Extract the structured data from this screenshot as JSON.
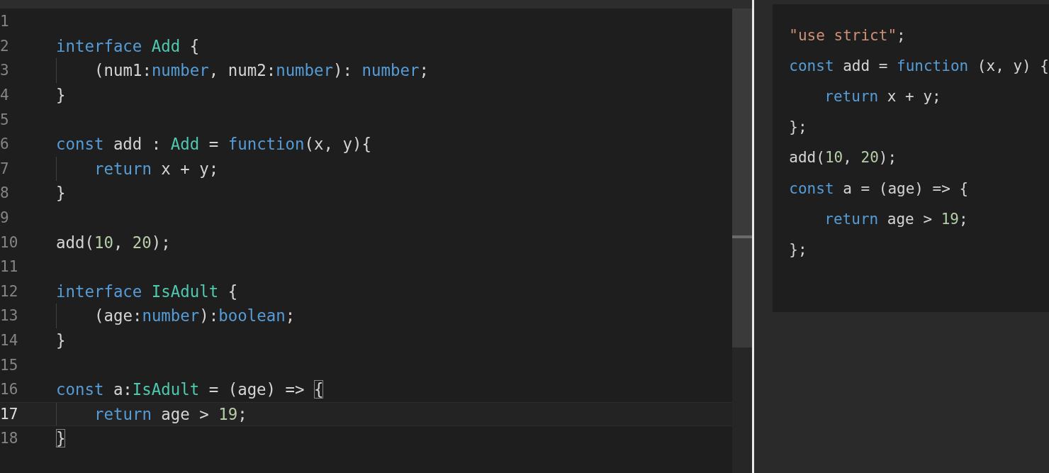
{
  "editor": {
    "lines": [
      {
        "number": "1",
        "current": false,
        "indented": false
      },
      {
        "number": "2",
        "current": false,
        "indented": false,
        "tokens": [
          {
            "text": "interface ",
            "kind": "keyword"
          },
          {
            "text": "Add",
            "kind": "type"
          },
          {
            "text": " {",
            "kind": "plain"
          }
        ]
      },
      {
        "number": "3",
        "current": false,
        "indented": true,
        "tokens": [
          {
            "text": "(num1:",
            "kind": "plain"
          },
          {
            "text": "number",
            "kind": "keyword"
          },
          {
            "text": ", num2:",
            "kind": "plain"
          },
          {
            "text": "number",
            "kind": "keyword"
          },
          {
            "text": "): ",
            "kind": "plain"
          },
          {
            "text": "number",
            "kind": "keyword"
          },
          {
            "text": ";",
            "kind": "plain"
          }
        ]
      },
      {
        "number": "4",
        "current": false,
        "indented": false,
        "tokens": [
          {
            "text": "}",
            "kind": "plain"
          }
        ]
      },
      {
        "number": "5",
        "current": false,
        "indented": false
      },
      {
        "number": "6",
        "current": false,
        "indented": false,
        "tokens": [
          {
            "text": "const",
            "kind": "keyword"
          },
          {
            "text": " add : ",
            "kind": "plain"
          },
          {
            "text": "Add",
            "kind": "type"
          },
          {
            "text": " = ",
            "kind": "plain"
          },
          {
            "text": "function",
            "kind": "keyword"
          },
          {
            "text": "(x, y){",
            "kind": "plain"
          }
        ]
      },
      {
        "number": "7",
        "current": false,
        "indented": true,
        "tokens": [
          {
            "text": "return",
            "kind": "keyword"
          },
          {
            "text": " x + y;",
            "kind": "plain"
          }
        ]
      },
      {
        "number": "8",
        "current": false,
        "indented": false,
        "tokens": [
          {
            "text": "}",
            "kind": "plain"
          }
        ]
      },
      {
        "number": "9",
        "current": false,
        "indented": false
      },
      {
        "number": "10",
        "current": false,
        "indented": false,
        "tokens": [
          {
            "text": "add(",
            "kind": "plain"
          },
          {
            "text": "10",
            "kind": "number"
          },
          {
            "text": ", ",
            "kind": "plain"
          },
          {
            "text": "20",
            "kind": "number"
          },
          {
            "text": ");",
            "kind": "plain"
          }
        ]
      },
      {
        "number": "11",
        "current": false,
        "indented": false
      },
      {
        "number": "12",
        "current": false,
        "indented": false,
        "tokens": [
          {
            "text": "interface ",
            "kind": "keyword"
          },
          {
            "text": "IsAdult",
            "kind": "type"
          },
          {
            "text": " {",
            "kind": "plain"
          }
        ]
      },
      {
        "number": "13",
        "current": false,
        "indented": true,
        "tokens": [
          {
            "text": "(age:",
            "kind": "plain"
          },
          {
            "text": "number",
            "kind": "keyword"
          },
          {
            "text": "):",
            "kind": "plain"
          },
          {
            "text": "boolean",
            "kind": "keyword"
          },
          {
            "text": ";",
            "kind": "plain"
          }
        ]
      },
      {
        "number": "14",
        "current": false,
        "indented": false,
        "tokens": [
          {
            "text": "}",
            "kind": "plain"
          }
        ]
      },
      {
        "number": "15",
        "current": false,
        "indented": false
      },
      {
        "number": "16",
        "current": false,
        "indented": false,
        "tokens": [
          {
            "text": "const",
            "kind": "keyword"
          },
          {
            "text": " a:",
            "kind": "plain"
          },
          {
            "text": "IsAdult",
            "kind": "type"
          },
          {
            "text": " = (age) => ",
            "kind": "plain"
          },
          {
            "text": "{",
            "kind": "bracket-match"
          }
        ]
      },
      {
        "number": "17",
        "current": true,
        "indented": true,
        "tokens": [
          {
            "text": "return",
            "kind": "keyword"
          },
          {
            "text": " age > ",
            "kind": "plain"
          },
          {
            "text": "19",
            "kind": "number"
          },
          {
            "text": ";",
            "kind": "plain"
          }
        ]
      },
      {
        "number": "18",
        "current": false,
        "indented": false,
        "tokens": [
          {
            "text": "}",
            "kind": "bracket-match"
          }
        ]
      }
    ]
  },
  "output": {
    "lines": [
      {
        "indented": false,
        "tokens": [
          {
            "text": "\"use strict\"",
            "kind": "string"
          },
          {
            "text": ";",
            "kind": "plain"
          }
        ]
      },
      {
        "indented": false,
        "tokens": [
          {
            "text": "const",
            "kind": "keyword"
          },
          {
            "text": " add = ",
            "kind": "plain"
          },
          {
            "text": "function",
            "kind": "keyword"
          },
          {
            "text": " (x, y) {",
            "kind": "plain"
          }
        ]
      },
      {
        "indented": true,
        "tokens": [
          {
            "text": "return",
            "kind": "keyword"
          },
          {
            "text": " x + y;",
            "kind": "plain"
          }
        ]
      },
      {
        "indented": false,
        "tokens": [
          {
            "text": "};",
            "kind": "plain"
          }
        ]
      },
      {
        "indented": false,
        "tokens": [
          {
            "text": "add(",
            "kind": "plain"
          },
          {
            "text": "10",
            "kind": "number"
          },
          {
            "text": ", ",
            "kind": "plain"
          },
          {
            "text": "20",
            "kind": "number"
          },
          {
            "text": ");",
            "kind": "plain"
          }
        ]
      },
      {
        "indented": false,
        "tokens": [
          {
            "text": "const",
            "kind": "keyword"
          },
          {
            "text": " a = (age) => {",
            "kind": "plain"
          }
        ]
      },
      {
        "indented": true,
        "tokens": [
          {
            "text": "return",
            "kind": "keyword"
          },
          {
            "text": " age > ",
            "kind": "plain"
          },
          {
            "text": "19",
            "kind": "number"
          },
          {
            "text": ";",
            "kind": "plain"
          }
        ]
      },
      {
        "indented": false,
        "tokens": [
          {
            "text": "};",
            "kind": "plain"
          }
        ]
      }
    ]
  }
}
